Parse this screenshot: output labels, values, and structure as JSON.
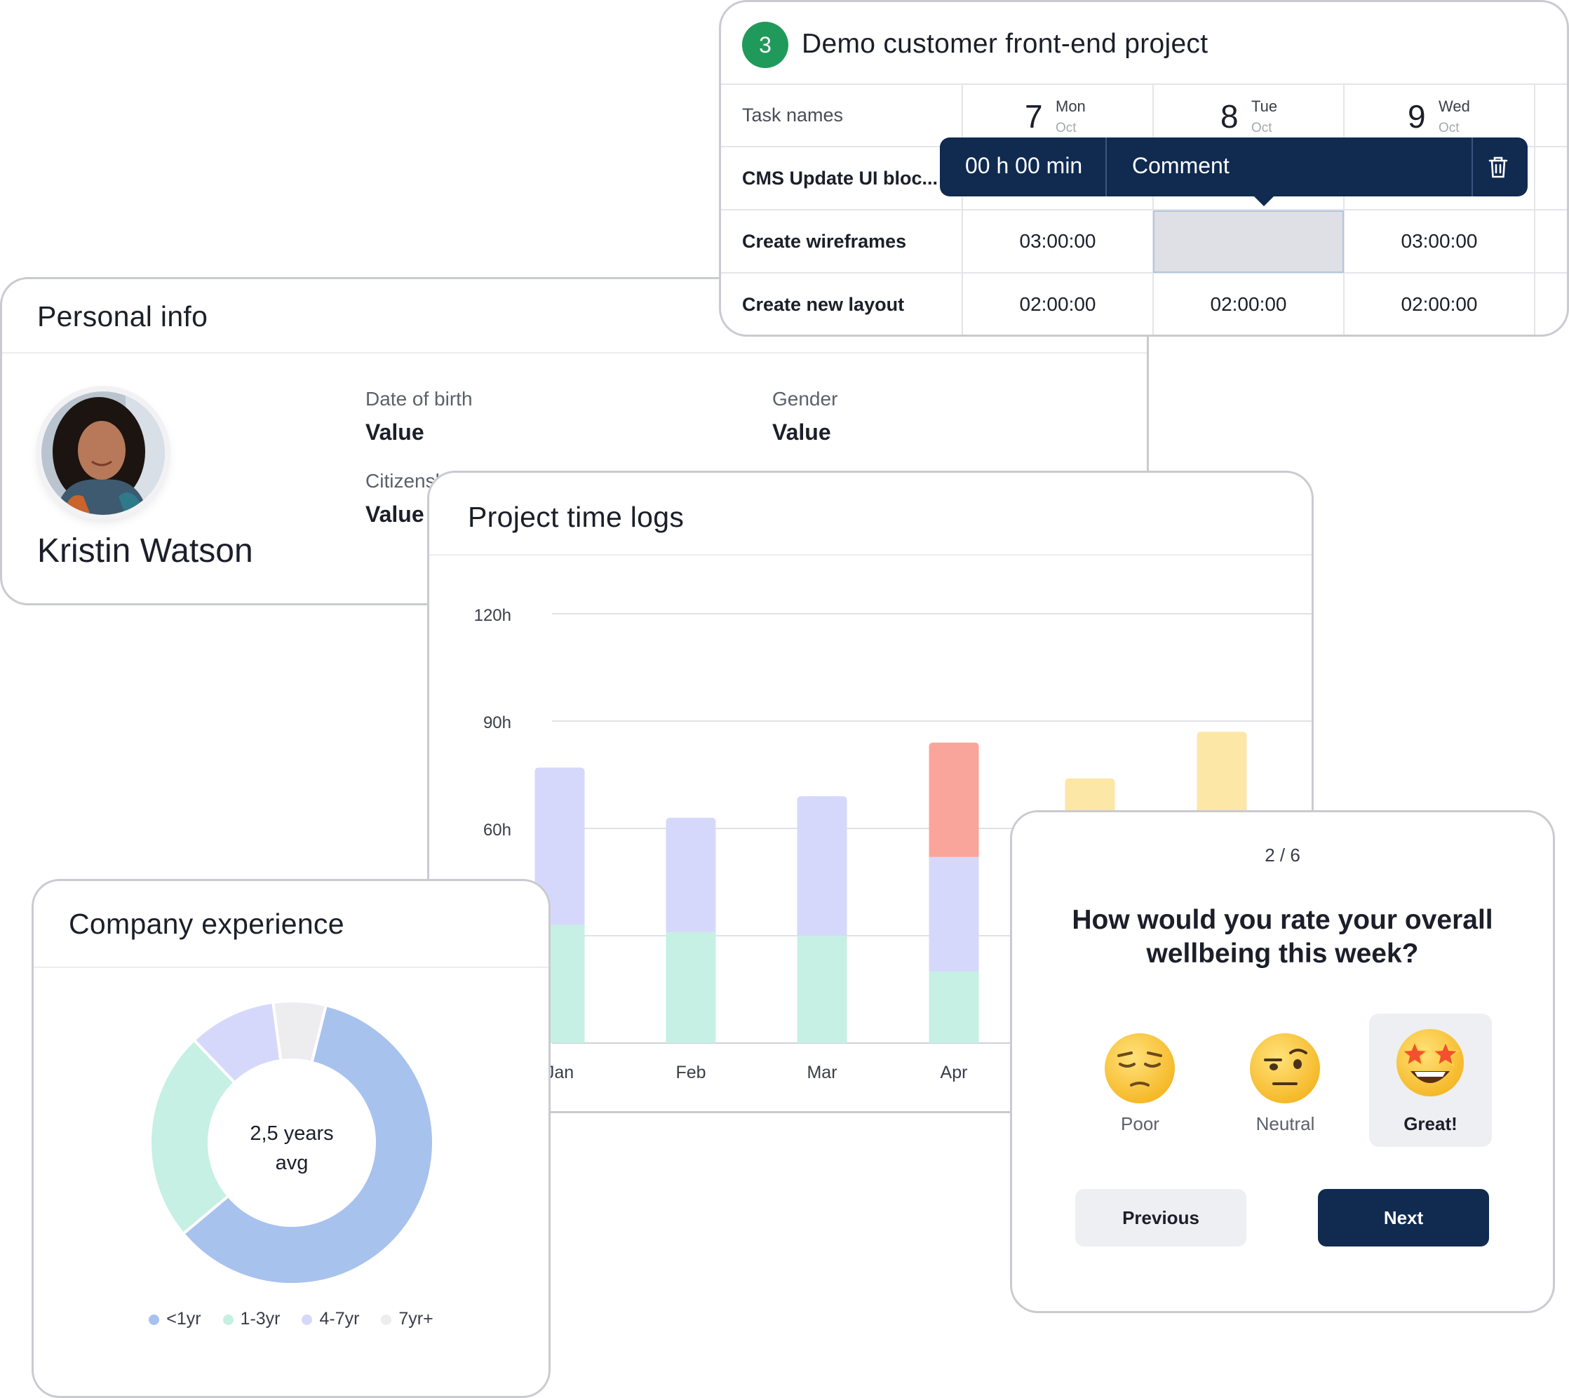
{
  "personal_info": {
    "title": "Personal info",
    "name": "Kristin Watson",
    "fields": {
      "dob_label": "Date of birth",
      "dob_value": "Value",
      "gender_label": "Gender",
      "gender_value": "Value",
      "citizenship_label": "Citizensl",
      "citizenship_value": "Value"
    }
  },
  "timesheet": {
    "badge": "3",
    "title": "Demo customer front-end project",
    "task_header": "Task names",
    "days": [
      {
        "num": "7",
        "name": "Mon",
        "month": "Oct"
      },
      {
        "num": "8",
        "name": "Tue",
        "month": "Oct"
      },
      {
        "num": "9",
        "name": "Wed",
        "month": "Oct"
      }
    ],
    "rows": [
      {
        "task": "CMS Update UI bloc...",
        "values": [
          "",
          "",
          ""
        ]
      },
      {
        "task": "Create wireframes",
        "values": [
          "03:00:00",
          "",
          "03:00:00"
        ]
      },
      {
        "task": "Create new layout",
        "values": [
          "02:00:00",
          "02:00:00",
          "02:00:00"
        ]
      }
    ],
    "popover": {
      "time": "00 h 00 min",
      "comment": "Comment",
      "icon": "trash-icon"
    }
  },
  "time_logs": {
    "title": "Project time logs"
  },
  "chart_data": [
    {
      "type": "bar",
      "title": "Project time logs",
      "stacked": true,
      "categories": [
        "Jan",
        "Feb",
        "Mar",
        "Apr",
        "",
        ""
      ],
      "yticks": [
        "120h",
        "90h",
        "60h"
      ],
      "ylim": [
        0,
        120
      ],
      "grid": true,
      "series": [
        {
          "color": "#c5f0e3",
          "values": [
            33,
            31,
            30,
            20,
            0,
            0
          ]
        },
        {
          "color": "#d6d8fb",
          "values": [
            44,
            32,
            39,
            32,
            0,
            0
          ]
        },
        {
          "color": "#f9a59b",
          "values": [
            0,
            0,
            0,
            32,
            0,
            0
          ]
        },
        {
          "color": "#fde7a7",
          "values": [
            0,
            0,
            0,
            0,
            74,
            87
          ]
        }
      ]
    },
    {
      "type": "pie",
      "title": "Company experience",
      "center_label_line1": "2,5 years",
      "center_label_line2": "avg",
      "labels": [
        "<1yr",
        "1-3yr",
        "4-7yr",
        "7yr+"
      ],
      "values": [
        60,
        24,
        10,
        6
      ],
      "colors": [
        "#a8c2ee",
        "#c5f0e3",
        "#d6d8fb",
        "#ededf0"
      ]
    }
  ],
  "experience": {
    "title": "Company experience",
    "legend": [
      "<1yr",
      "1-3yr",
      "4-7yr",
      "7yr+"
    ]
  },
  "wellbeing": {
    "step": "2 / 6",
    "question": "How would you rate your overall wellbeing this week?",
    "options": [
      "Poor",
      "Neutral",
      "Great!"
    ],
    "selected": "Great!",
    "previous": "Previous",
    "next": "Next"
  }
}
